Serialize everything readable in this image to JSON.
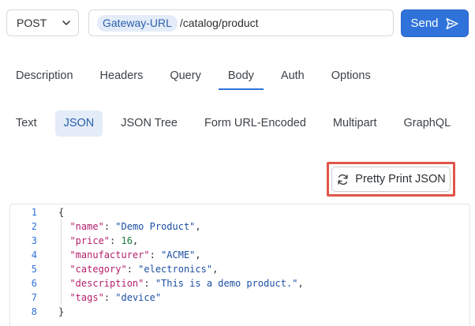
{
  "request": {
    "method": "POST",
    "url_variable": "Gateway-URL",
    "url_path": "/catalog/product",
    "send_label": "Send"
  },
  "tabs": [
    {
      "label": "Description",
      "active": false
    },
    {
      "label": "Headers",
      "active": false
    },
    {
      "label": "Query",
      "active": false
    },
    {
      "label": "Body",
      "active": true
    },
    {
      "label": "Auth",
      "active": false
    },
    {
      "label": "Options",
      "active": false
    }
  ],
  "body_tabs": [
    {
      "label": "Text",
      "active": false
    },
    {
      "label": "JSON",
      "active": true
    },
    {
      "label": "JSON Tree",
      "active": false
    },
    {
      "label": "Form URL-Encoded",
      "active": false
    },
    {
      "label": "Multipart",
      "active": false
    },
    {
      "label": "GraphQL",
      "active": false
    }
  ],
  "pretty_print_label": "Pretty Print JSON",
  "editor": {
    "line_numbers": [
      "1",
      "2",
      "3",
      "4",
      "5",
      "6",
      "7",
      "8"
    ],
    "lines": [
      [
        {
          "t": "{",
          "c": "p"
        }
      ],
      [
        {
          "t": "  ",
          "c": "p"
        },
        {
          "t": "\"name\"",
          "c": "k"
        },
        {
          "t": ": ",
          "c": "p"
        },
        {
          "t": "\"Demo Product\"",
          "c": "s"
        },
        {
          "t": ",",
          "c": "p"
        }
      ],
      [
        {
          "t": "  ",
          "c": "p"
        },
        {
          "t": "\"price\"",
          "c": "k"
        },
        {
          "t": ": ",
          "c": "p"
        },
        {
          "t": "16",
          "c": "n"
        },
        {
          "t": ",",
          "c": "p"
        }
      ],
      [
        {
          "t": "  ",
          "c": "p"
        },
        {
          "t": "\"manufacturer\"",
          "c": "k"
        },
        {
          "t": ": ",
          "c": "p"
        },
        {
          "t": "\"ACME\"",
          "c": "s"
        },
        {
          "t": ",",
          "c": "p"
        }
      ],
      [
        {
          "t": "  ",
          "c": "p"
        },
        {
          "t": "\"category\"",
          "c": "k"
        },
        {
          "t": ": ",
          "c": "p"
        },
        {
          "t": "\"electronics\"",
          "c": "s"
        },
        {
          "t": ",",
          "c": "p"
        }
      ],
      [
        {
          "t": "  ",
          "c": "p"
        },
        {
          "t": "\"description\"",
          "c": "k"
        },
        {
          "t": ": ",
          "c": "p"
        },
        {
          "t": "\"This is a demo product.\"",
          "c": "s"
        },
        {
          "t": ",",
          "c": "p"
        }
      ],
      [
        {
          "t": "  ",
          "c": "p"
        },
        {
          "t": "\"tags\"",
          "c": "k"
        },
        {
          "t": ": ",
          "c": "p"
        },
        {
          "t": "\"device\"",
          "c": "s"
        }
      ],
      [
        {
          "t": "}",
          "c": "p"
        }
      ]
    ]
  },
  "colors": {
    "accent": "#2f73da",
    "highlight_outline": "#e0564a",
    "json_key": "#b3206d",
    "json_string": "#1c4fa3",
    "json_number": "#1a7a46"
  },
  "icons": {
    "method_dropdown": "chevron-down-icon",
    "send": "send-icon",
    "pretty_print": "refresh-icon"
  }
}
